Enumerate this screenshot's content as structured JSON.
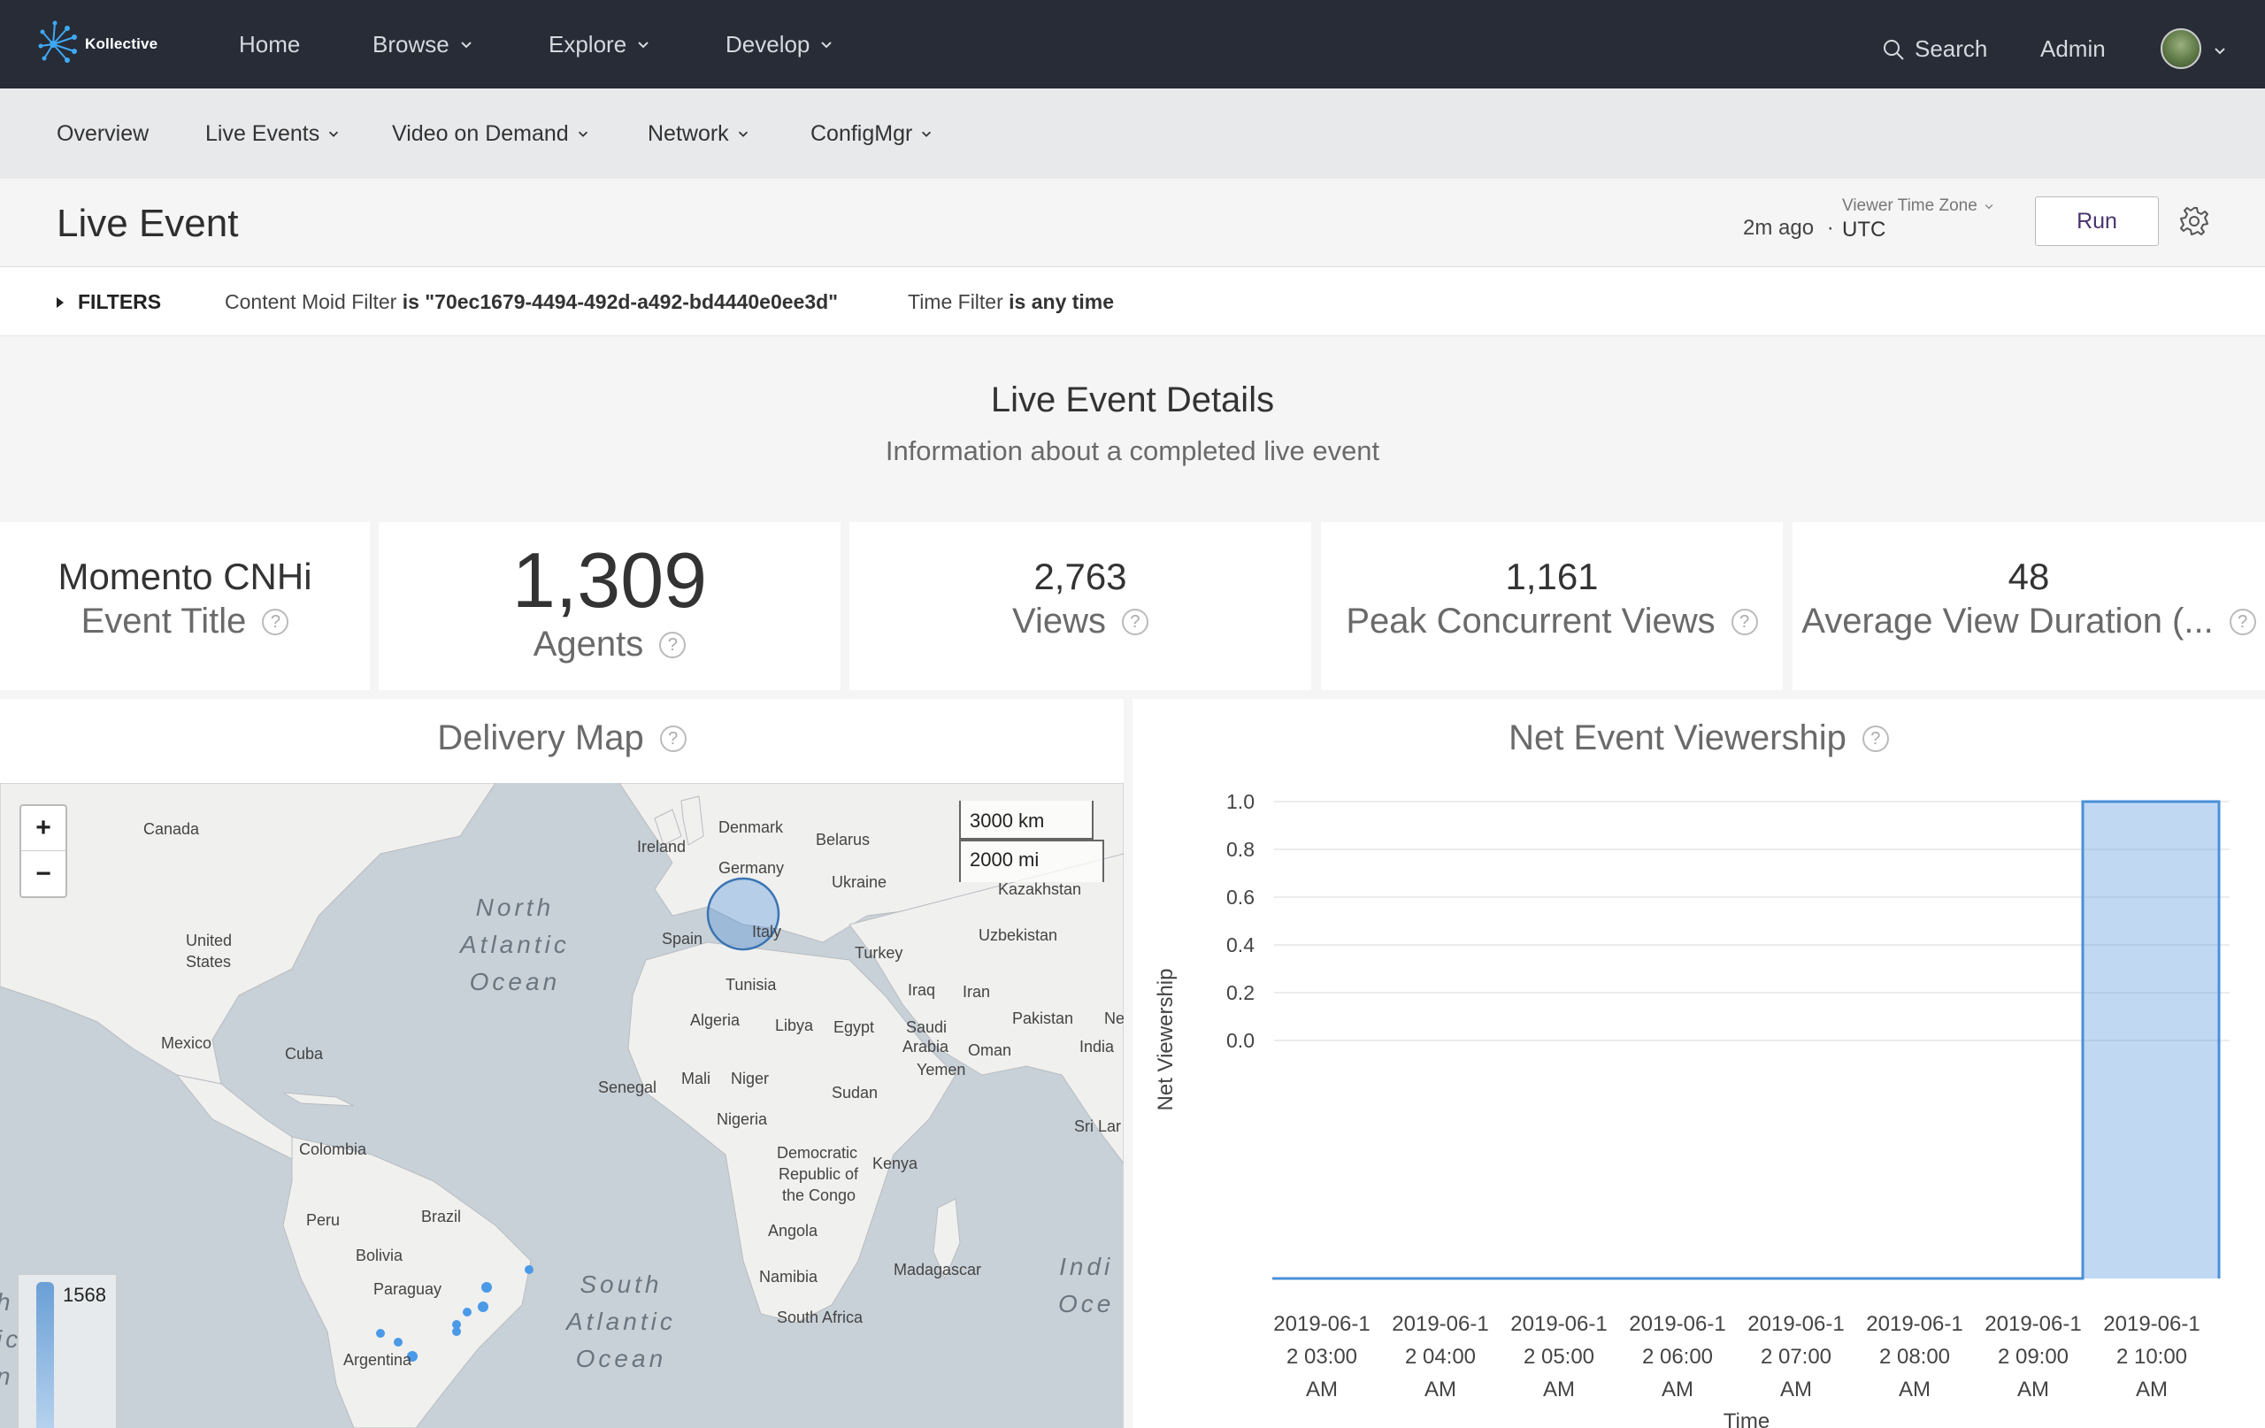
{
  "app": {
    "brand": "Kollective",
    "nav": [
      {
        "label": "Home"
      },
      {
        "label": "Browse"
      },
      {
        "label": "Explore"
      },
      {
        "label": "Develop"
      }
    ],
    "search_label": "Search",
    "admin_label": "Admin"
  },
  "subnav": [
    {
      "label": "Overview"
    },
    {
      "label": "Live Events"
    },
    {
      "label": "Video on Demand"
    },
    {
      "label": "Network"
    },
    {
      "label": "ConfigMgr"
    }
  ],
  "header": {
    "title": "Live Event",
    "last_run": "2m ago",
    "separator": "·",
    "tz_label": "Viewer Time Zone",
    "tz_value": "UTC",
    "run_label": "Run"
  },
  "filters": {
    "toggle_label": "FILTERS",
    "f1_name": "Content Moid Filter",
    "f1_value": "is \"70ec1679-4494-492d-a492-bd4440e0ee3d\"",
    "f2_name": "Time Filter",
    "f2_value": "is any time"
  },
  "section": {
    "title": "Live Event Details",
    "subtitle": "Information about a completed live event"
  },
  "tiles": [
    {
      "value": "Momento CNHi",
      "label": "Event Title"
    },
    {
      "value": "1,309",
      "label": "Agents"
    },
    {
      "value": "2,763",
      "label": "Views"
    },
    {
      "value": "1,161",
      "label": "Peak Concurrent Views"
    },
    {
      "value": "48",
      "label": "Average View Duration (..."
    }
  ],
  "map": {
    "title": "Delivery Map",
    "zoom_in": "+",
    "zoom_out": "−",
    "scale_km": "3000 km",
    "scale_mi": "2000 mi",
    "legend_max": "1568",
    "labels": {
      "canada": "Canada",
      "us1": "United",
      "us2": "States",
      "mexico": "Mexico",
      "cuba": "Cuba",
      "colombia": "Colombia",
      "peru": "Peru",
      "brazil": "Brazil",
      "bolivia": "Bolivia",
      "paraguay": "Paraguay",
      "argentina": "Argentina",
      "ireland": "Ireland",
      "denmark": "Denmark",
      "belarus": "Belarus",
      "germany": "Germany",
      "ukraine": "Ukraine",
      "kazakhstan": "Kazakhstan",
      "spain": "Spain",
      "italy": "Italy",
      "uzbekistan": "Uzbekistan",
      "turkey": "Turkey",
      "tunisia": "Tunisia",
      "iraq": "Iraq",
      "iran": "Iran",
      "algeria": "Algeria",
      "libya": "Libya",
      "egypt": "Egypt",
      "saudi1": "Saudi",
      "saudi2": "Arabia",
      "pakistan": "Pakistan",
      "ne": "Ne",
      "oman": "Oman",
      "india": "India",
      "yemen": "Yemen",
      "mali": "Mali",
      "niger": "Niger",
      "senegal": "Senegal",
      "sudan": "Sudan",
      "nigeria": "Nigeria",
      "srilanka": "Sri Lar",
      "drc1": "Democratic",
      "drc2": "Republic of",
      "drc3": "the Congo",
      "kenya": "Kenya",
      "angola": "Angola",
      "namibia": "Namibia",
      "madagascar": "Madagascar",
      "southafrica": "South Africa",
      "na_ocean1": "North",
      "na_ocean2": "Atlantic",
      "na_ocean3": "Ocean",
      "sa_ocean1": "South",
      "sa_ocean2": "Atlantic",
      "sa_ocean3": "Ocean",
      "in_ocean1": "Indi",
      "in_ocean2": "Oce",
      "edge1": "h",
      "edge2": "ic",
      "edge3": "n"
    }
  },
  "chart_title": "Net Event Viewership",
  "chart_data": {
    "type": "area",
    "title": "Net Event Viewership",
    "xlabel": "Time",
    "ylabel": "Net Viewership",
    "yticks": [
      "1.0",
      "0.8",
      "0.6",
      "0.4",
      "0.2",
      "0.0"
    ],
    "categories": [
      "2019-06-12 03:00 AM",
      "2019-06-12 04:00 AM",
      "2019-06-12 05:00 AM",
      "2019-06-12 06:00 AM",
      "2019-06-12 07:00 AM",
      "2019-06-12 08:00 AM",
      "2019-06-12 09:00 AM",
      "2019-06-12 10:00 AM"
    ],
    "tick_lines": [
      [
        "2019-06-1",
        "2 03:00",
        "AM"
      ],
      [
        "2019-06-1",
        "2 04:00",
        "AM"
      ],
      [
        "2019-06-1",
        "2 05:00",
        "AM"
      ],
      [
        "2019-06-1",
        "2 06:00",
        "AM"
      ],
      [
        "2019-06-1",
        "2 07:00",
        "AM"
      ],
      [
        "2019-06-1",
        "2 08:00",
        "AM"
      ],
      [
        "2019-06-1",
        "2 09:00",
        "AM"
      ],
      [
        "2019-06-1",
        "2 10:00",
        "AM"
      ]
    ],
    "series": [
      {
        "values": [
          0,
          0,
          0,
          0,
          0,
          0,
          0,
          1
        ]
      }
    ],
    "ylim": [
      0,
      1.0
    ],
    "grid": true,
    "color": "#4a90d9"
  }
}
